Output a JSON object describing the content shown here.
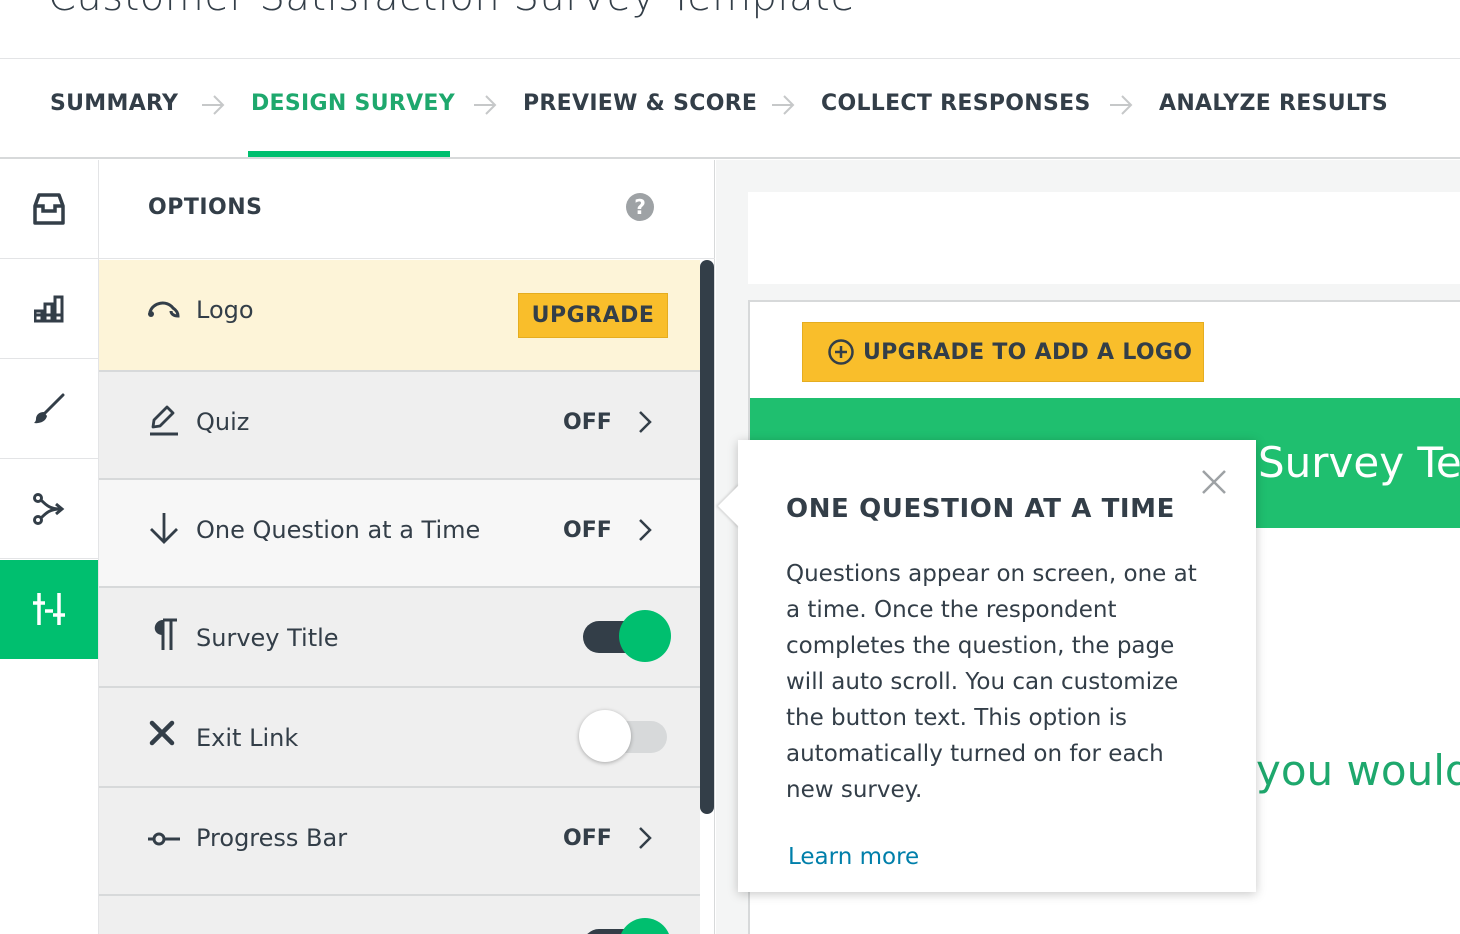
{
  "header": {
    "title": "Customer Satisfaction Survey Template"
  },
  "steps": [
    {
      "label": "SUMMARY",
      "active": false
    },
    {
      "label": "DESIGN SURVEY",
      "active": true
    },
    {
      "label": "PREVIEW & SCORE",
      "active": false
    },
    {
      "label": "COLLECT RESPONSES",
      "active": false
    },
    {
      "label": "ANALYZE RESULTS",
      "active": false
    }
  ],
  "rail": {
    "items": [
      {
        "icon": "question-bank-icon",
        "active": false
      },
      {
        "icon": "builder-icon",
        "active": false
      },
      {
        "icon": "paintbrush-icon",
        "active": false
      },
      {
        "icon": "logic-icon",
        "active": false
      },
      {
        "icon": "options-sliders-icon",
        "active": true
      }
    ]
  },
  "options": {
    "title": "OPTIONS",
    "help_icon": "?",
    "rows": [
      {
        "label": "Logo",
        "icon": "logo-icon",
        "action": "UPGRADE"
      },
      {
        "label": "Quiz",
        "icon": "pencil-icon",
        "value": "OFF"
      },
      {
        "label": "One Question at a Time",
        "icon": "arrow-down-icon",
        "value": "OFF"
      },
      {
        "label": "Survey Title",
        "icon": "paragraph-icon",
        "toggle": "on"
      },
      {
        "label": "Exit Link",
        "icon": "x-icon",
        "toggle": "off"
      },
      {
        "label": "Progress Bar",
        "icon": "progress-bar-icon",
        "value": "OFF"
      }
    ]
  },
  "canvas": {
    "logo_button": "UPGRADE TO ADD A LOGO",
    "survey_title_partial": "n Survey Te",
    "question_partial": "you would"
  },
  "popover": {
    "title": "ONE QUESTION AT A TIME",
    "body": "Questions appear on screen, one at a time. Once the respondent completes the question, the page will auto scroll. You can customize the button text. This option is automatically turned on for each new survey.",
    "link": "Learn more"
  },
  "colors": {
    "brand_green": "#00bf6f",
    "upgrade_yellow": "#f9be2b",
    "text_dark": "#333e48",
    "link_blue": "#007faa"
  }
}
